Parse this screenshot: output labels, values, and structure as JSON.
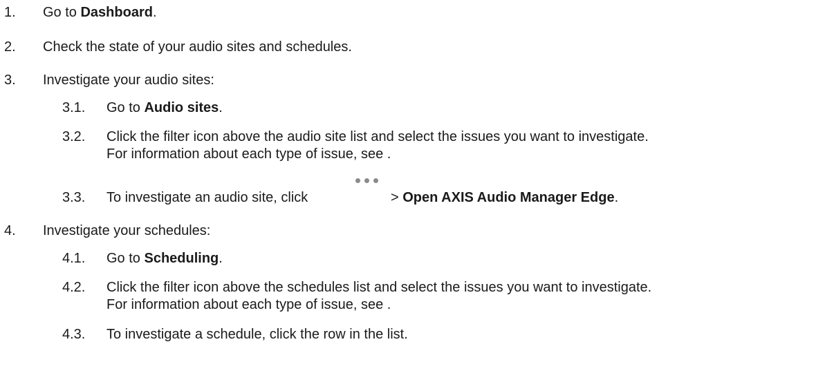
{
  "steps": [
    {
      "num": "1.",
      "text_a": "Go to ",
      "bold": "Dashboard",
      "text_b": "."
    },
    {
      "num": "2.",
      "text": "Check the state of your audio sites and schedules."
    },
    {
      "num": "3.",
      "text": "Investigate your audio sites:",
      "sub": [
        {
          "num": "3.1.",
          "text_a": "Go to ",
          "bold": "Audio sites",
          "text_b": "."
        },
        {
          "num": "3.2.",
          "line1": "Click the filter icon above the audio site list and select the issues you want to investigate.",
          "line2": "For information about each type of issue, see ."
        },
        {
          "num": "3.3.",
          "text_a": "To investigate an audio site, click",
          "icon": "more-options-icon",
          "text_b": "> ",
          "bold": "Open AXIS Audio Manager Edge",
          "text_c": "."
        }
      ]
    },
    {
      "num": "4.",
      "text": "Investigate your schedules:",
      "sub": [
        {
          "num": "4.1.",
          "text_a": "Go to ",
          "bold": "Scheduling",
          "text_b": "."
        },
        {
          "num": "4.2.",
          "line1": "Click the filter icon above the schedules list and select the issues you want to investigate.",
          "line2": "For information about each type of issue, see ."
        },
        {
          "num": "4.3.",
          "text": "To investigate a schedule, click the row in the list."
        }
      ]
    }
  ]
}
